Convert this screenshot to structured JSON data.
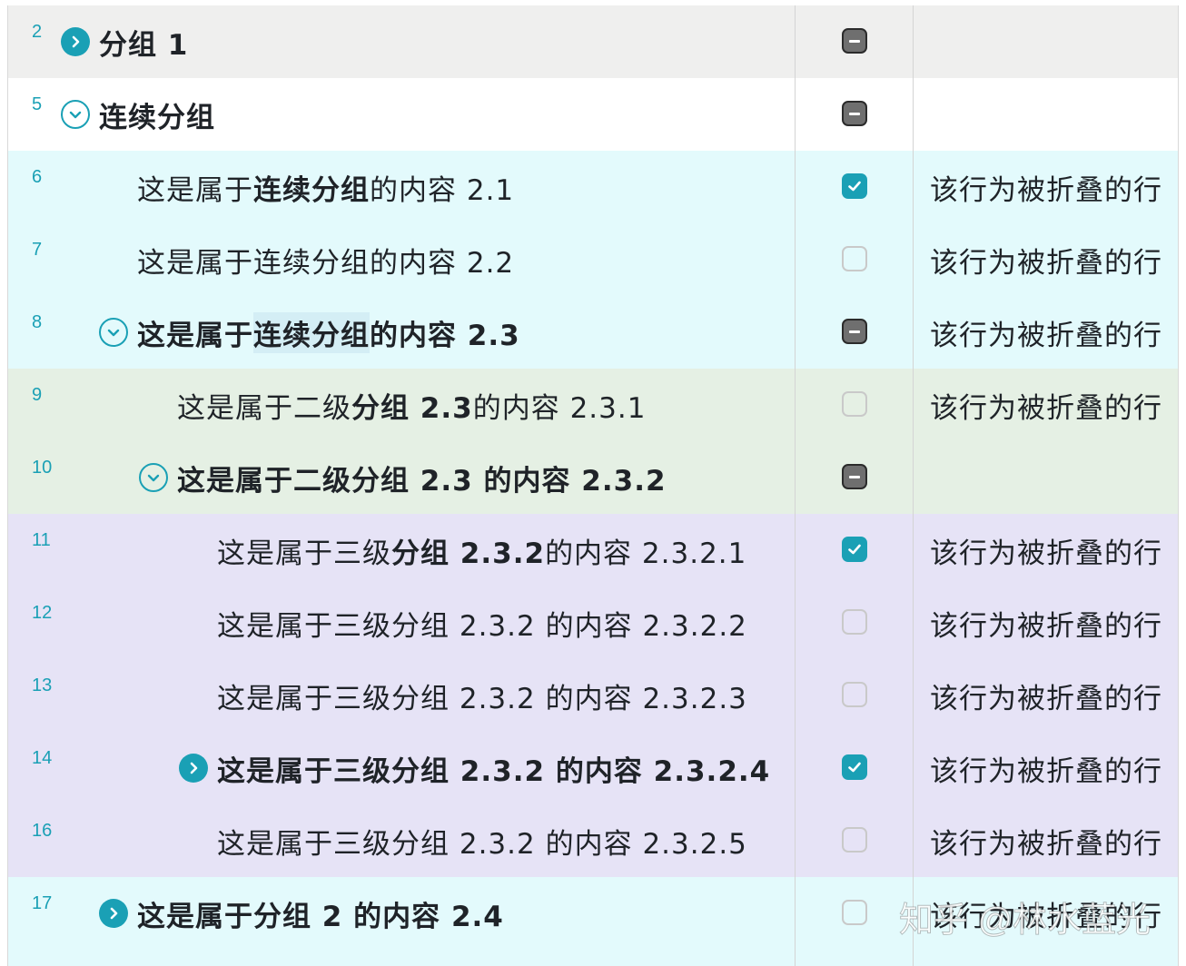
{
  "colors": {
    "accent": "#1aa0b5",
    "row_gray": "#efefee",
    "row_cyan": "#e3fafc",
    "row_green": "#e5f0e4",
    "row_purple": "#e6e3f6"
  },
  "rows": [
    {
      "line": "2",
      "toggle": "chevron-right-icon collapsed",
      "checkbox": "mixed",
      "segments": [
        "分组 1"
      ],
      "note": ""
    },
    {
      "line": "5",
      "toggle": "chevron-down-icon expanded",
      "checkbox": "mixed",
      "segments": [
        "连续分组"
      ],
      "note": ""
    },
    {
      "line": "6",
      "toggle": "",
      "checkbox": "checked",
      "segments": [
        "这是属于",
        "连续分组",
        "的内容 2.1"
      ],
      "note": "该行为被折叠的行"
    },
    {
      "line": "7",
      "toggle": "",
      "checkbox": "unchecked",
      "segments": [
        "这是属于连续分组的内容 2.2"
      ],
      "note": "该行为被折叠的行"
    },
    {
      "line": "8",
      "toggle": "chevron-down-icon expanded",
      "checkbox": "mixed",
      "segments": [
        "这是属于",
        "连续分组",
        "的内容 2.3"
      ],
      "note": "该行为被折叠的行"
    },
    {
      "line": "9",
      "toggle": "",
      "checkbox": "unchecked",
      "segments": [
        "这是属于二级",
        "分组 2.3",
        " 的内容 2.3.1"
      ],
      "note": "该行为被折叠的行"
    },
    {
      "line": "10",
      "toggle": "chevron-down-icon expanded",
      "checkbox": "mixed",
      "segments": [
        "这是属于二级分组 2.3 的内容 2.3.2"
      ],
      "note": ""
    },
    {
      "line": "11",
      "toggle": "",
      "checkbox": "checked",
      "segments": [
        "这是属于三级",
        "分组 2.3.2",
        " 的内容 2.3.2.1"
      ],
      "note": "该行为被折叠的行"
    },
    {
      "line": "12",
      "toggle": "",
      "checkbox": "unchecked",
      "segments": [
        "这是属于三级分组 2.3.2 的内容 2.3.2.2"
      ],
      "note": "该行为被折叠的行"
    },
    {
      "line": "13",
      "toggle": "",
      "checkbox": "unchecked",
      "segments": [
        "这是属于三级分组 2.3.2 的内容 2.3.2.3"
      ],
      "note": "该行为被折叠的行"
    },
    {
      "line": "14",
      "toggle": "chevron-right-icon collapsed",
      "checkbox": "checked",
      "segments": [
        "这是属于三级分组 2.3.2 的内容 2.3.2.4"
      ],
      "note": "该行为被折叠的行"
    },
    {
      "line": "16",
      "toggle": "",
      "checkbox": "unchecked",
      "segments": [
        "这是属于三级分组 2.3.2 的内容 2.3.2.5"
      ],
      "note": "该行为被折叠的行"
    },
    {
      "line": "17",
      "toggle": "chevron-right-icon collapsed",
      "checkbox": "unchecked",
      "segments": [
        "这是属于分组 2 的内容 2.4"
      ],
      "note": "该行为被折叠的行"
    }
  ],
  "watermark": "知乎 @林水蓝光"
}
